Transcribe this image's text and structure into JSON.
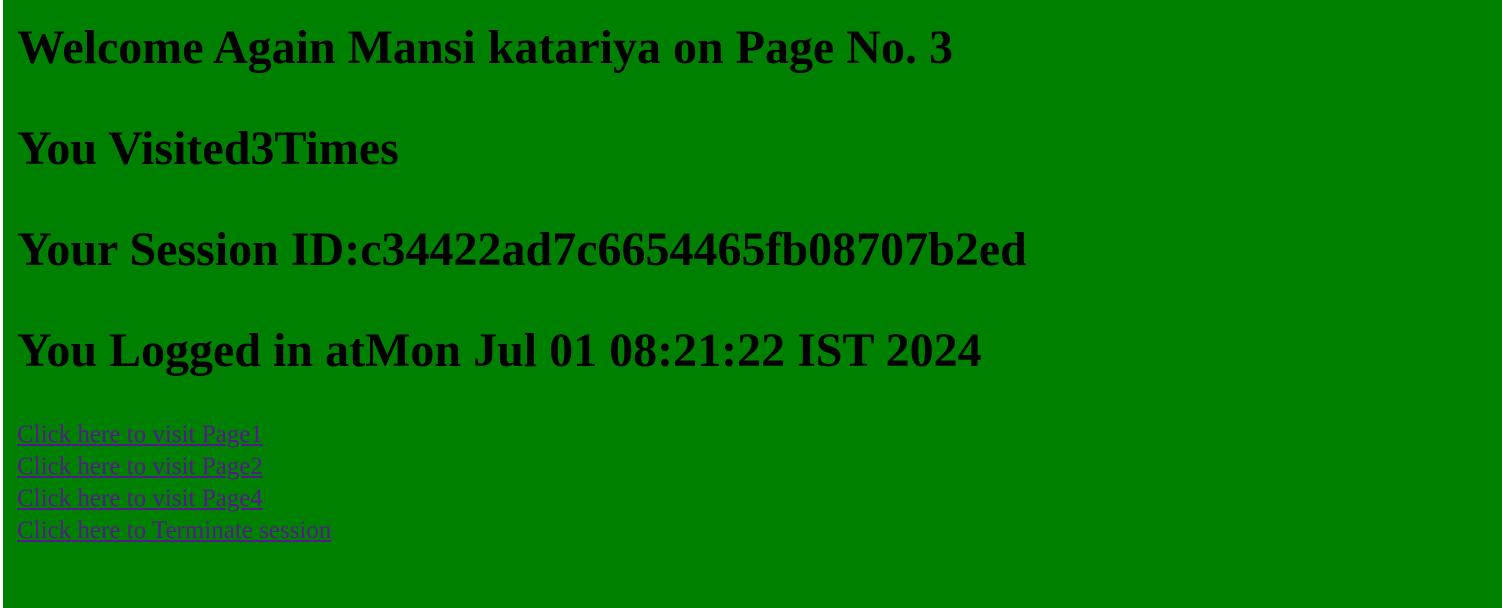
{
  "welcome": "Welcome Again Mansi katariya on Page No. 3",
  "visited": "You Visited3Times",
  "session": "Your Session ID:c34422ad7c6654465fb08707b2ed",
  "login": "You Logged in atMon Jul 01 08:21:22 IST 2024",
  "links": [
    {
      "label": "Click here to visit Page1"
    },
    {
      "label": "Click here to visit Page2"
    },
    {
      "label": "Click here to visit Page4"
    },
    {
      "label": "Click here to Terminate session"
    }
  ],
  "colors": {
    "background": "#008000",
    "visited_link": "#551a8b",
    "text": "#000000"
  }
}
